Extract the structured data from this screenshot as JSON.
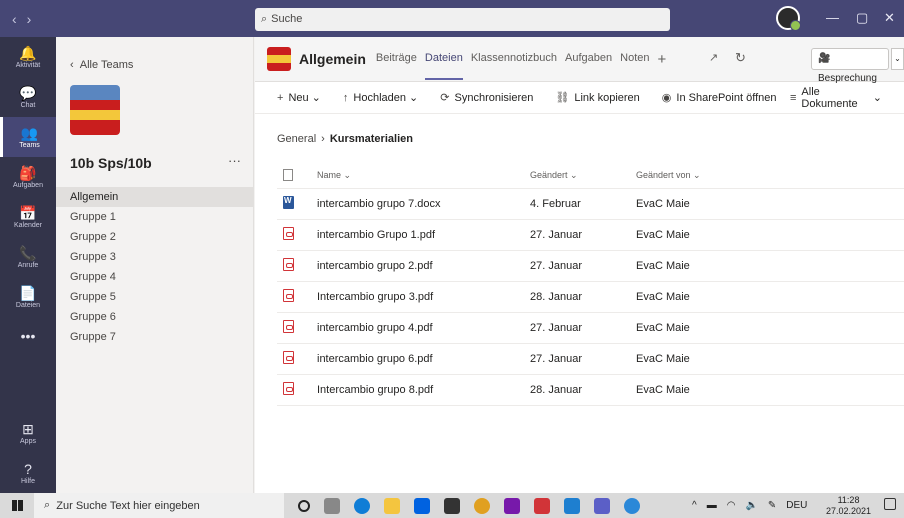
{
  "search": {
    "placeholder": "Suche"
  },
  "rail": [
    {
      "label": "Aktivität",
      "icon": "bell-icon",
      "glyph": "🔔"
    },
    {
      "label": "Chat",
      "icon": "chat-icon",
      "glyph": "💬"
    },
    {
      "label": "Teams",
      "icon": "teams-icon",
      "glyph": "👥"
    },
    {
      "label": "Aufgaben",
      "icon": "tasks-icon",
      "glyph": "🎒"
    },
    {
      "label": "Kalender",
      "icon": "calendar-icon",
      "glyph": "📅"
    },
    {
      "label": "Anrufe",
      "icon": "phone-icon",
      "glyph": "📞"
    },
    {
      "label": "Dateien",
      "icon": "files-icon",
      "glyph": "📄"
    },
    {
      "label": "",
      "icon": "more-icon",
      "glyph": "•••"
    }
  ],
  "rail_bottom": [
    {
      "label": "Apps",
      "icon": "apps-icon",
      "glyph": "⊞"
    },
    {
      "label": "Hilfe",
      "icon": "help-icon",
      "glyph": "?"
    }
  ],
  "teams_panel": {
    "back": "Alle Teams",
    "team_name": "10b Sps/10b",
    "channels": [
      "Allgemein",
      "Gruppe 1",
      "Gruppe 2",
      "Gruppe 3",
      "Gruppe 4",
      "Gruppe 5",
      "Gruppe 6",
      "Gruppe 7"
    ]
  },
  "header": {
    "title": "Allgemein",
    "tabs": [
      "Beiträge",
      "Dateien",
      "Klassennotizbuch",
      "Aufgaben",
      "Noten"
    ],
    "meeting": "Besprechung"
  },
  "toolbar": {
    "new": "Neu",
    "upload": "Hochladen",
    "sync": "Synchronisieren",
    "copy_link": "Link kopieren",
    "sharepoint": "In SharePoint öffnen",
    "all_docs": "Alle Dokumente"
  },
  "breadcrumb": {
    "root": "General",
    "current": "Kursmaterialien"
  },
  "table": {
    "headers": {
      "name": "Name",
      "modified": "Geändert",
      "modified_by": "Geändert von"
    },
    "rows": [
      {
        "name": "intercambio grupo 7.docx",
        "modified": "4. Februar",
        "by": "EvaC Maie",
        "type": "word"
      },
      {
        "name": "intercambio Grupo 1.pdf",
        "modified": "27. Januar",
        "by": "EvaC Maie",
        "type": "pdf"
      },
      {
        "name": "intercambio grupo 2.pdf",
        "modified": "27. Januar",
        "by": "EvaC Maie",
        "type": "pdf"
      },
      {
        "name": "Intercambio grupo 3.pdf",
        "modified": "28. Januar",
        "by": "EvaC Maie",
        "type": "pdf"
      },
      {
        "name": "intercambio grupo 4.pdf",
        "modified": "27. Januar",
        "by": "EvaC Maie",
        "type": "pdf"
      },
      {
        "name": "intercambio grupo 6.pdf",
        "modified": "27. Januar",
        "by": "EvaC Maie",
        "type": "pdf"
      },
      {
        "name": "Intercambio grupo 8.pdf",
        "modified": "28. Januar",
        "by": "EvaC Maie",
        "type": "pdf"
      }
    ]
  },
  "taskbar": {
    "search": "Zur Suche Text hier eingeben",
    "lang": "DEU",
    "time": "11:28",
    "date": "27.02.2021"
  },
  "colors": {
    "titlebar": "#464775",
    "rail": "#33344a",
    "accent": "#6264a7"
  }
}
